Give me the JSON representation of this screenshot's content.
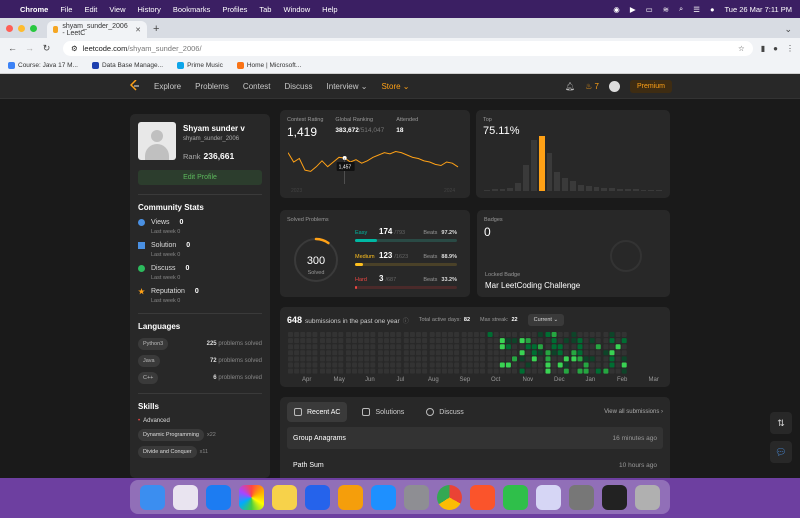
{
  "menubar": {
    "app": "Chrome",
    "items": [
      "File",
      "Edit",
      "View",
      "History",
      "Bookmarks",
      "Profiles",
      "Tab",
      "Window",
      "Help"
    ],
    "datetime": "Tue 26 Mar  7:11 PM"
  },
  "browser": {
    "tab_title": "shyam_sunder_2006 - LeetC",
    "url_host": "leetcode.com",
    "url_path": "/shyam_sunder_2006/",
    "bookmarks": [
      "Course: Java 17 M...",
      "Data Base Manage...",
      "Prime Music",
      "Home | Microsoft..."
    ]
  },
  "nav": {
    "links": [
      "Explore",
      "Problems",
      "Contest",
      "Discuss",
      "Interview ⌄",
      "Store ⌄"
    ],
    "streak": "7",
    "premium": "Premium"
  },
  "profile": {
    "name": "Shyam sunder v",
    "handle": "shyam_sunder_2006",
    "rank_label": "Rank",
    "rank": "236,661",
    "edit": "Edit Profile"
  },
  "community": {
    "title": "Community Stats",
    "stats": [
      {
        "label": "Views",
        "value": "0",
        "sub": "Last week 0",
        "color": "#4a90e2"
      },
      {
        "label": "Solution",
        "value": "0",
        "sub": "Last week 0",
        "color": "#4a90e2"
      },
      {
        "label": "Discuss",
        "value": "0",
        "sub": "Last week 0",
        "color": "#2cbb5d"
      },
      {
        "label": "Reputation",
        "value": "0",
        "sub": "Last week 0",
        "color": "#ffa116"
      }
    ]
  },
  "languages": {
    "title": "Languages",
    "items": [
      {
        "name": "Python3",
        "count": "225",
        "suffix": "problems solved"
      },
      {
        "name": "Java",
        "count": "72",
        "suffix": "problems solved"
      },
      {
        "name": "C++",
        "count": "6",
        "suffix": "problems solved"
      }
    ]
  },
  "skills": {
    "title": "Skills",
    "level": "Advanced",
    "items": [
      {
        "name": "Dynamic Programming",
        "count": "x22"
      },
      {
        "name": "Divide and Conquer",
        "count": "x11"
      }
    ]
  },
  "contest": {
    "rating_label": "Contest Rating",
    "rating": "1,419",
    "global_label": "Global Ranking",
    "global": "383,672",
    "global_total": "/514,047",
    "attended_label": "Attended",
    "attended": "18",
    "tooltip": "1,457",
    "x_left": "2023",
    "x_right": "2024",
    "series": [
      1480,
      1440,
      1455,
      1405,
      1400,
      1420,
      1445,
      1420,
      1440,
      1460,
      1457,
      1440,
      1450,
      1435,
      1445,
      1460,
      1470,
      1480,
      1475,
      1485,
      1480,
      1470,
      1460,
      1455,
      1445,
      1440,
      1430,
      1425,
      1440,
      1435,
      1419
    ]
  },
  "top": {
    "label": "Top",
    "value": "75.11%",
    "histogram": [
      1,
      2,
      2,
      3,
      8,
      25,
      48,
      52,
      36,
      18,
      12,
      9,
      6,
      5,
      4,
      3,
      3,
      2,
      2,
      2,
      1,
      1,
      1
    ],
    "highlight_index": 7
  },
  "solved": {
    "title": "Solved Problems",
    "total": "300",
    "total_label": "Solved",
    "fraction": 0.1,
    "difficulties": [
      {
        "name": "Easy",
        "count": "174",
        "total": "/793",
        "beats_label": "Beats",
        "beats": "97.2%",
        "fraction": 0.22,
        "color": "#00b8a3",
        "track": "#2a4a45"
      },
      {
        "name": "Medium",
        "count": "123",
        "total": "/1623",
        "beats_label": "Beats",
        "beats": "88.9%",
        "fraction": 0.076,
        "color": "#ffc01e",
        "track": "#4a4128"
      },
      {
        "name": "Hard",
        "count": "3",
        "total": "/687",
        "beats_label": "Beats",
        "beats": "33.2%",
        "fraction": 0.004,
        "color": "#ef4743",
        "track": "#4a2a2a"
      }
    ]
  },
  "badges": {
    "label": "Badges",
    "count": "0",
    "recent_label": "Locked Badge",
    "recent": "Mar LeetCoding Challenge"
  },
  "heatmap": {
    "count": "648",
    "text": "submissions in the past one year",
    "active_label": "Total active days:",
    "active": "82",
    "streak_label": "Max streak:",
    "streak": "22",
    "select": "Current",
    "months": [
      "Apr",
      "May",
      "Jun",
      "Jul",
      "Aug",
      "Sep",
      "Oct",
      "Nov",
      "Dec",
      "Jan",
      "Feb",
      "Mar"
    ]
  },
  "recent": {
    "tabs": [
      "Recent AC",
      "Solutions",
      "Discuss"
    ],
    "view_all": "View all submissions",
    "rows": [
      {
        "title": "Group Anagrams",
        "time": "16 minutes ago"
      },
      {
        "title": "Path Sum",
        "time": "10 hours ago"
      }
    ]
  },
  "colors": {
    "accent": "#ffa116",
    "easy": "#00b8a3",
    "medium": "#ffc01e",
    "hard": "#ef4743",
    "heat_levels": [
      "#333333",
      "#0e4429",
      "#006d32",
      "#26a641",
      "#39d353"
    ]
  },
  "dock": {
    "apps": [
      "finder-icon",
      "launchpad-icon",
      "safari-icon",
      "photos-icon",
      "notes-icon",
      "keynote-icon",
      "pages-icon",
      "app-store-icon",
      "settings-icon",
      "chrome-icon",
      "brave-icon",
      "numbers-icon",
      "preview-icon",
      "xcode-icon",
      "activity-monitor-icon",
      "trash-icon"
    ]
  }
}
